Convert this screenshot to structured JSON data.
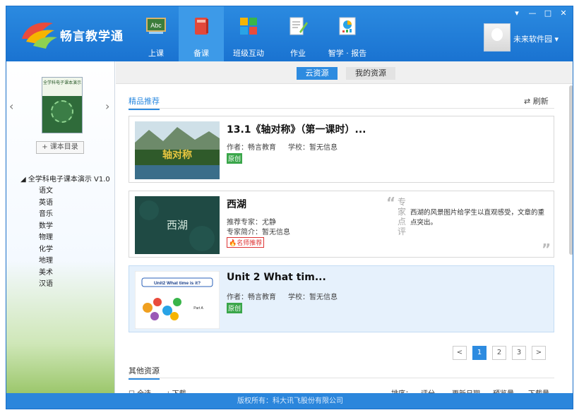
{
  "app": {
    "name": "畅言教学通"
  },
  "nav": [
    {
      "label": "上课",
      "icon": "abc-board-icon"
    },
    {
      "label": "备课",
      "icon": "red-book-icon"
    },
    {
      "label": "班级互动",
      "icon": "blocks-icon"
    },
    {
      "label": "作业",
      "icon": "pen-paper-icon"
    },
    {
      "label": "智学 · 报告",
      "icon": "report-icon"
    }
  ],
  "user": {
    "name": "未来软件园"
  },
  "window_controls": [
    "▾",
    "—",
    "□",
    "✕"
  ],
  "sidebar": {
    "book_title": "全学科电子课本演示",
    "toc_button": "课本目录",
    "tree_root": "全学科电子课本演示 V1.0",
    "subjects": [
      "语文",
      "英语",
      "音乐",
      "数学",
      "物理",
      "化学",
      "地理",
      "美术",
      "汉语"
    ]
  },
  "tabs": {
    "cloud": "云资源",
    "mine": "我的资源"
  },
  "featured": {
    "title": "精品推荐",
    "refresh": "刷新",
    "items": [
      {
        "title": "13.1《轴对称》（第一课时）...",
        "author_label": "作者：畅言教育",
        "school_label": "学校：暂无信息",
        "badge": "原创",
        "thumb_text": "轴对称"
      },
      {
        "title": "西湖",
        "expert_label": "推荐专家：尤静",
        "intro_label": "专家简介：暂无信息",
        "badge": "名师推荐",
        "thumb_text": "西湖",
        "review_side": "专家点评",
        "review": "西湖的风景图片给学生以直观感受，文章的重点突出。"
      },
      {
        "title": "Unit 2 What tim...",
        "author_label": "作者：畅言教育",
        "school_label": "学校：暂无信息",
        "badge": "原创",
        "thumb_text": "Unit2 What time is it?",
        "thumb_sub": "Part A"
      }
    ]
  },
  "pagination": [
    "<",
    "1",
    "2",
    "3",
    ">"
  ],
  "other": {
    "title": "其他资源",
    "select_all": "全选",
    "download": "下载",
    "sort_label": "排序：",
    "sort_opts": [
      "评分",
      "更新日期",
      "预览量",
      "下载量"
    ]
  },
  "footer": {
    "copyright": "版权所有：科大讯飞股份有限公司"
  }
}
